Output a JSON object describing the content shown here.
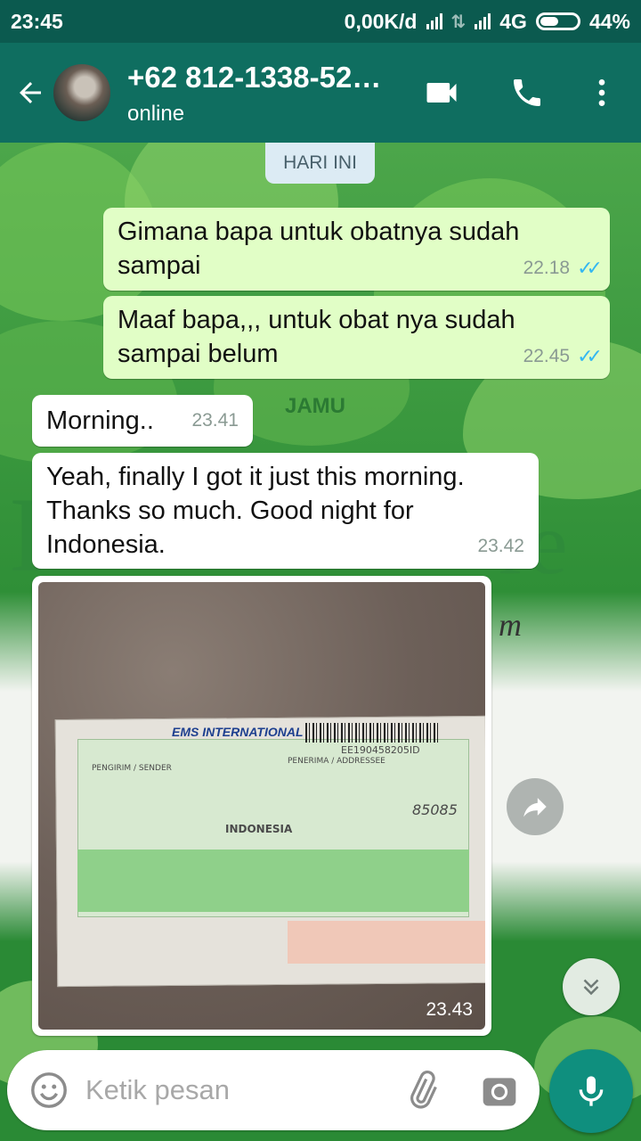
{
  "status_bar": {
    "time": "23:45",
    "net_speed": "0,00K/d",
    "network": "4G",
    "battery": "44%"
  },
  "header": {
    "contact": "+62 812-1338-52…",
    "status": "online",
    "icons": [
      "back-arrow-icon",
      "video-call-icon",
      "phone-icon",
      "more-vert-icon"
    ]
  },
  "background": {
    "jamu": "JAMU"
  },
  "chat": {
    "date_chip": "HARI INI",
    "messages": [
      {
        "dir": "out",
        "text": "Gimana bapa untuk obatnya sudah sampai",
        "time": "22.18",
        "read": true
      },
      {
        "dir": "out",
        "text": "Maaf bapa,,, untuk obat nya sudah sampai belum",
        "time": "22.45",
        "read": true
      },
      {
        "dir": "in",
        "text": "Morning..",
        "time": "23.41"
      },
      {
        "dir": "in",
        "text": "Yeah, finally I got it just this morning. Thanks so much. Good night for Indonesia.",
        "time": "23.42"
      },
      {
        "dir": "in",
        "type": "image",
        "time": "23.43"
      }
    ],
    "photo_label": {
      "ems": "EMS INTERNATIONAL",
      "tracking": "EE190458205ID",
      "addressee": "PENERIMA / ADDRESSEE",
      "sender": "PENGIRIM / SENDER",
      "country": "INDONESIA",
      "postcode": "85085"
    }
  },
  "composer": {
    "placeholder": "Ketik pesan"
  },
  "colors": {
    "header": "#0f6e60",
    "status_bar": "#0b5a4f",
    "outgoing_bubble": "#e1fec6",
    "incoming_bubble": "#ffffff",
    "read_ticks": "#34b7f1",
    "mic_button": "#0f8f7e"
  }
}
